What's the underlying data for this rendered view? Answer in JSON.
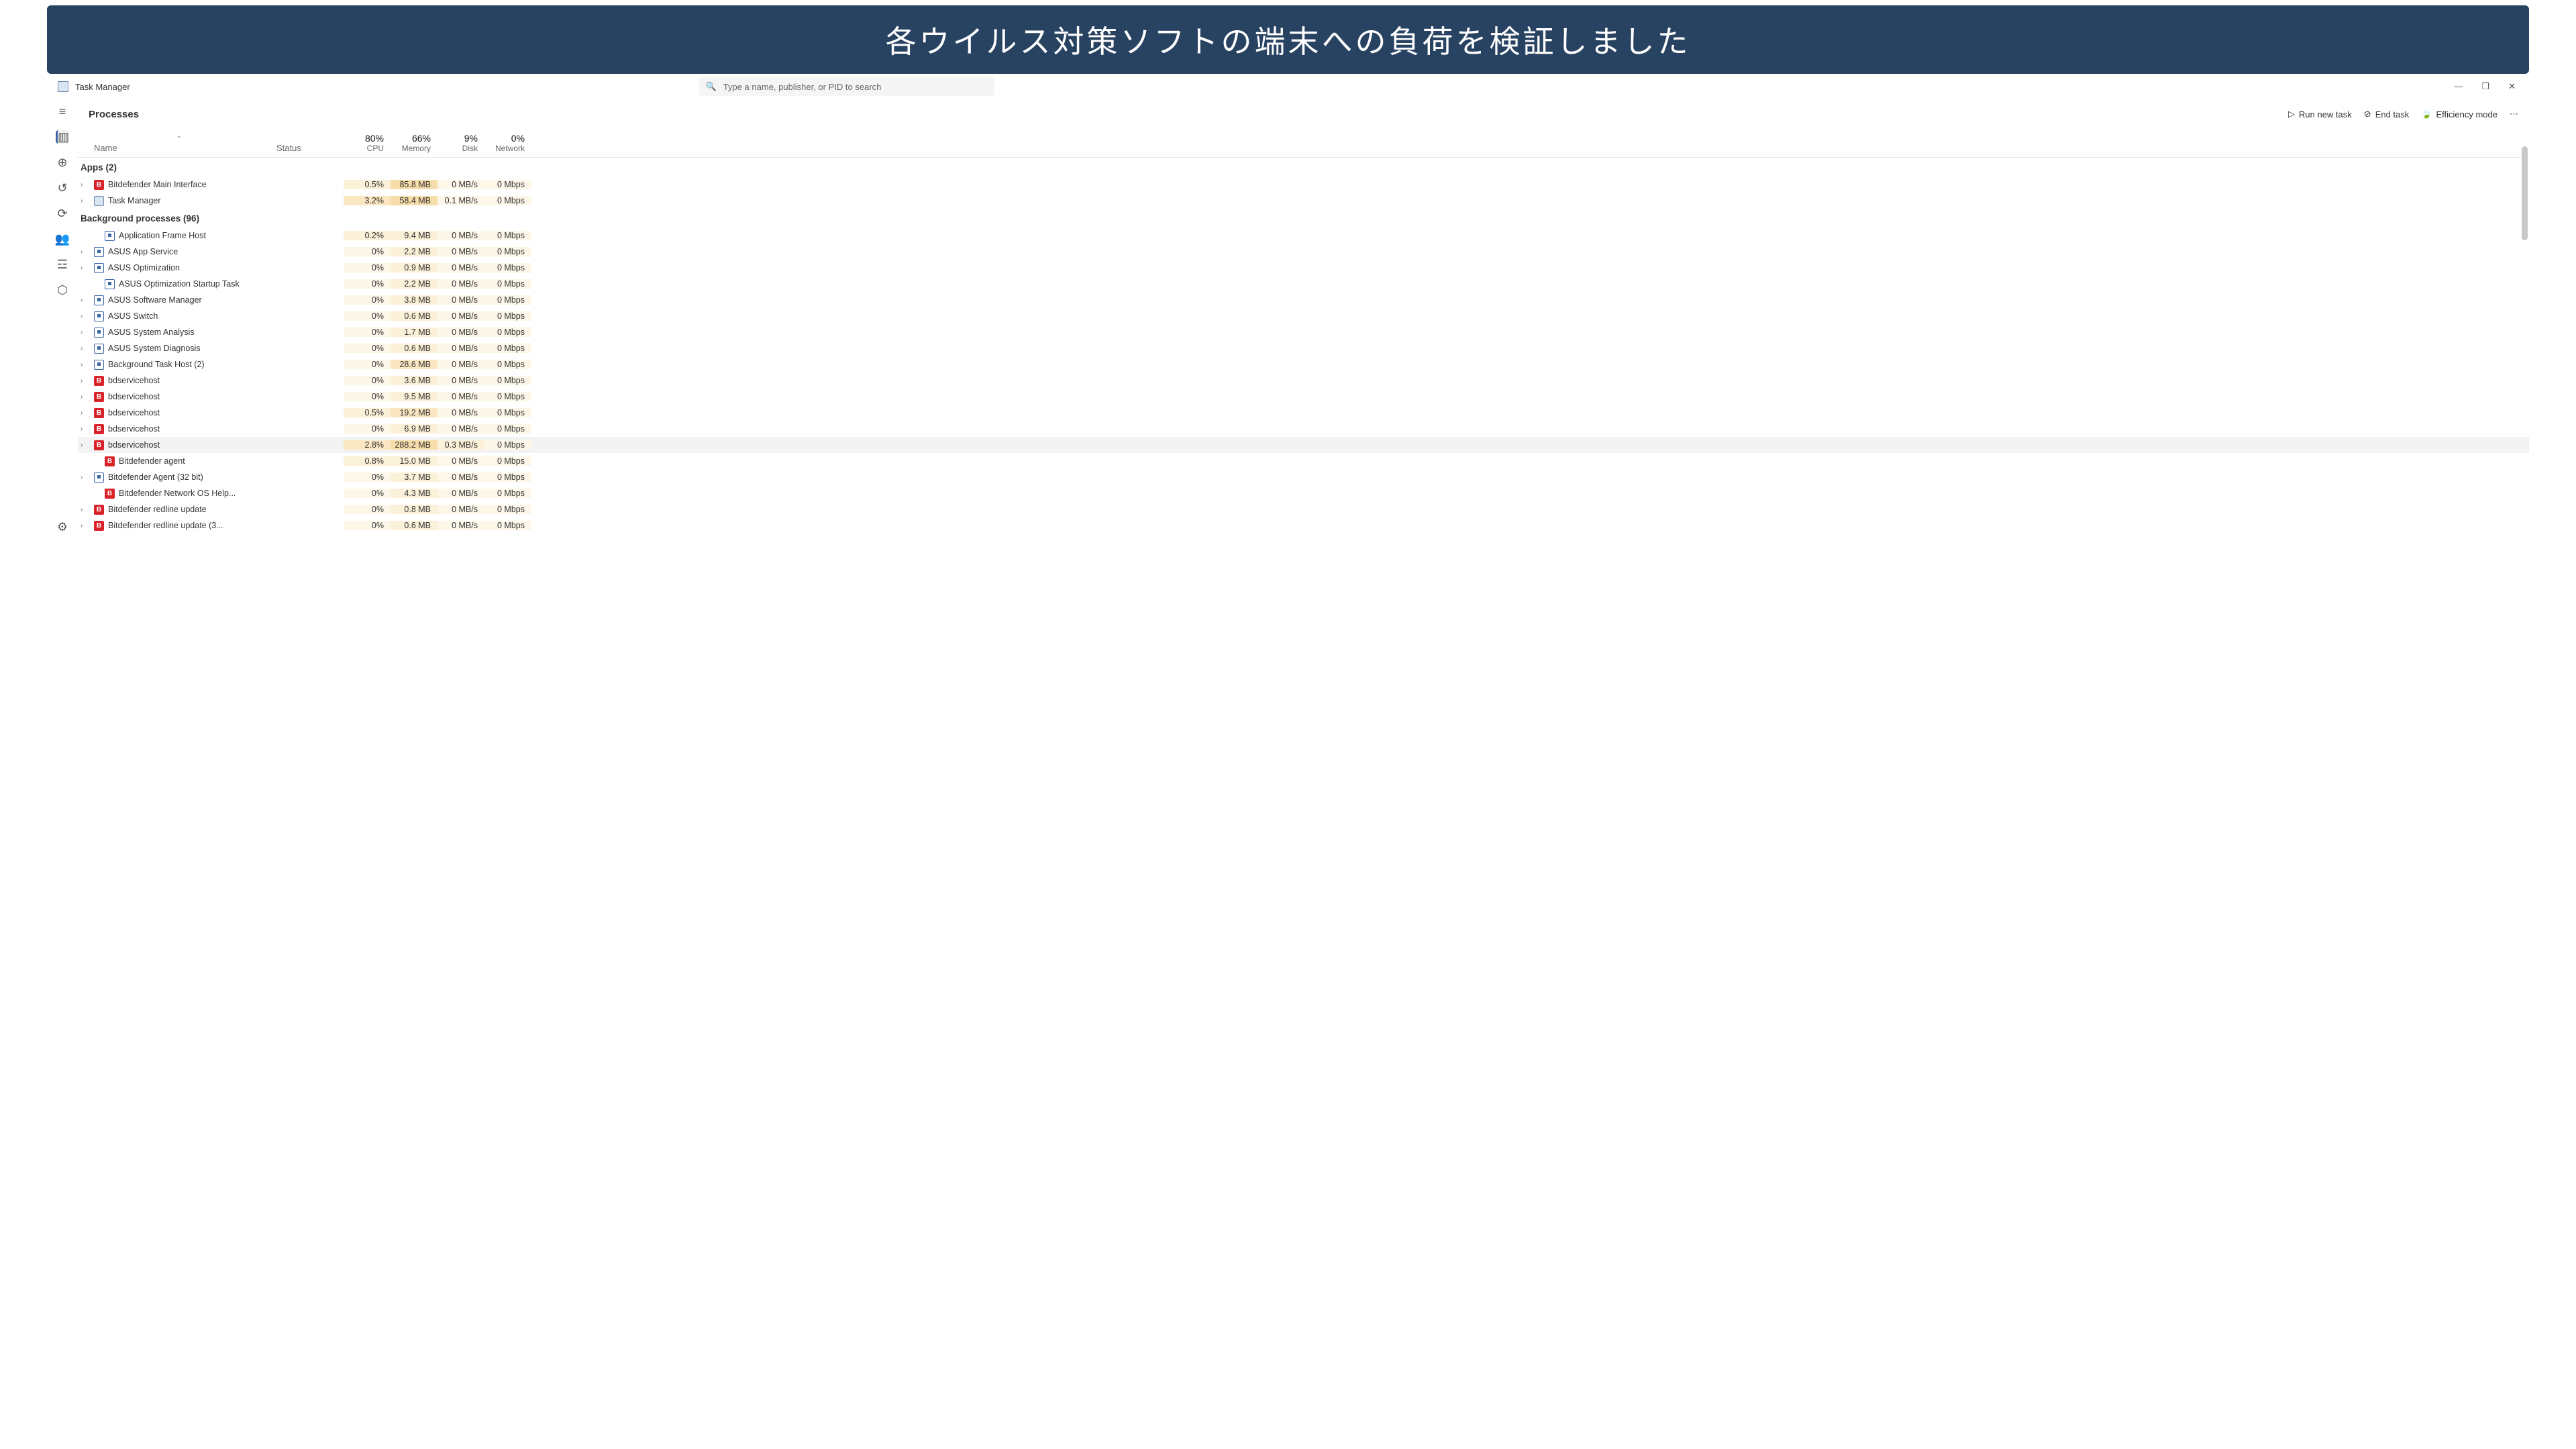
{
  "banner": "各ウイルス対策ソフトの端末への負荷を検証しました",
  "appTitle": "Task Manager",
  "searchPlaceholder": "Type a name, publisher, or PID to search",
  "pageHeading": "Processes",
  "actions": {
    "run": "Run new task",
    "end": "End task",
    "eff": "Efficiency mode"
  },
  "columns": {
    "name": "Name",
    "status": "Status",
    "cpu": {
      "pct": "80%",
      "lbl": "CPU"
    },
    "mem": {
      "pct": "66%",
      "lbl": "Memory"
    },
    "disk": {
      "pct": "9%",
      "lbl": "Disk"
    },
    "net": {
      "pct": "0%",
      "lbl": "Network"
    }
  },
  "groups": {
    "apps": "Apps (2)",
    "bg": "Background processes (96)"
  },
  "rows": [
    {
      "exp": true,
      "icon": "b",
      "name": "Bitdefender Main Interface",
      "cpu": "0.5%",
      "cpuH": 1,
      "mem": "85.8 MB",
      "memH": 3,
      "disk": "0 MB/s",
      "diskH": 0,
      "net": "0 Mbps",
      "netH": 0
    },
    {
      "exp": true,
      "icon": "tm",
      "name": "Task Manager",
      "cpu": "3.2%",
      "cpuH": 2,
      "mem": "58.4 MB",
      "memH": 3,
      "disk": "0.1 MB/s",
      "diskH": 0,
      "net": "0 Mbps",
      "netH": 0
    }
  ],
  "bgrows": [
    {
      "exp": false,
      "indent": true,
      "icon": "o",
      "name": "Application Frame Host",
      "cpu": "0.2%",
      "cpuH": 1,
      "mem": "9.4 MB",
      "memH": 1,
      "disk": "0 MB/s",
      "diskH": 0,
      "net": "0 Mbps",
      "netH": 0
    },
    {
      "exp": true,
      "icon": "o",
      "name": "ASUS App Service",
      "cpu": "0%",
      "cpuH": 0,
      "mem": "2.2 MB",
      "memH": 1,
      "disk": "0 MB/s",
      "diskH": 0,
      "net": "0 Mbps",
      "netH": 0
    },
    {
      "exp": true,
      "icon": "o",
      "name": "ASUS Optimization",
      "cpu": "0%",
      "cpuH": 0,
      "mem": "0.9 MB",
      "memH": 1,
      "disk": "0 MB/s",
      "diskH": 0,
      "net": "0 Mbps",
      "netH": 0
    },
    {
      "exp": false,
      "indent": true,
      "icon": "o",
      "name": "ASUS Optimization Startup Task",
      "cpu": "0%",
      "cpuH": 0,
      "mem": "2.2 MB",
      "memH": 1,
      "disk": "0 MB/s",
      "diskH": 0,
      "net": "0 Mbps",
      "netH": 0
    },
    {
      "exp": true,
      "icon": "o",
      "name": "ASUS Software Manager",
      "cpu": "0%",
      "cpuH": 0,
      "mem": "3.8 MB",
      "memH": 1,
      "disk": "0 MB/s",
      "diskH": 0,
      "net": "0 Mbps",
      "netH": 0
    },
    {
      "exp": true,
      "icon": "o",
      "name": "ASUS Switch",
      "cpu": "0%",
      "cpuH": 0,
      "mem": "0.6 MB",
      "memH": 1,
      "disk": "0 MB/s",
      "diskH": 0,
      "net": "0 Mbps",
      "netH": 0
    },
    {
      "exp": true,
      "icon": "o",
      "name": "ASUS System Analysis",
      "cpu": "0%",
      "cpuH": 0,
      "mem": "1.7 MB",
      "memH": 1,
      "disk": "0 MB/s",
      "diskH": 0,
      "net": "0 Mbps",
      "netH": 0
    },
    {
      "exp": true,
      "icon": "o",
      "name": "ASUS System Diagnosis",
      "cpu": "0%",
      "cpuH": 0,
      "mem": "0.6 MB",
      "memH": 1,
      "disk": "0 MB/s",
      "diskH": 0,
      "net": "0 Mbps",
      "netH": 0
    },
    {
      "exp": true,
      "icon": "o",
      "name": "Background Task Host (2)",
      "cpu": "0%",
      "cpuH": 0,
      "mem": "28.6 MB",
      "memH": 2,
      "disk": "0 MB/s",
      "diskH": 0,
      "net": "0 Mbps",
      "netH": 0
    },
    {
      "exp": true,
      "icon": "b",
      "name": "bdservicehost",
      "cpu": "0%",
      "cpuH": 0,
      "mem": "3.6 MB",
      "memH": 1,
      "disk": "0 MB/s",
      "diskH": 0,
      "net": "0 Mbps",
      "netH": 0
    },
    {
      "exp": true,
      "icon": "b",
      "name": "bdservicehost",
      "cpu": "0%",
      "cpuH": 0,
      "mem": "9.5 MB",
      "memH": 1,
      "disk": "0 MB/s",
      "diskH": 0,
      "net": "0 Mbps",
      "netH": 0
    },
    {
      "exp": true,
      "icon": "b",
      "name": "bdservicehost",
      "cpu": "0.5%",
      "cpuH": 1,
      "mem": "19.2 MB",
      "memH": 2,
      "disk": "0 MB/s",
      "diskH": 0,
      "net": "0 Mbps",
      "netH": 0
    },
    {
      "exp": true,
      "icon": "b",
      "name": "bdservicehost",
      "cpu": "0%",
      "cpuH": 0,
      "mem": "6.9 MB",
      "memH": 1,
      "disk": "0 MB/s",
      "diskH": 0,
      "net": "0 Mbps",
      "netH": 0
    },
    {
      "exp": true,
      "icon": "b",
      "name": "bdservicehost",
      "cpu": "2.8%",
      "cpuH": 2,
      "mem": "288.2 MB",
      "memH": 3,
      "disk": "0.3 MB/s",
      "diskH": 1,
      "net": "0 Mbps",
      "netH": 0,
      "sel": true
    },
    {
      "exp": false,
      "indent": true,
      "icon": "b",
      "name": "Bitdefender agent",
      "cpu": "0.8%",
      "cpuH": 1,
      "mem": "15.0 MB",
      "memH": 1,
      "disk": "0 MB/s",
      "diskH": 0,
      "net": "0 Mbps",
      "netH": 0
    },
    {
      "exp": true,
      "icon": "o",
      "name": "Bitdefender Agent (32 bit)",
      "cpu": "0%",
      "cpuH": 0,
      "mem": "3.7 MB",
      "memH": 1,
      "disk": "0 MB/s",
      "diskH": 0,
      "net": "0 Mbps",
      "netH": 0
    },
    {
      "exp": false,
      "indent": true,
      "icon": "b",
      "name": "Bitdefender Network OS Help...",
      "cpu": "0%",
      "cpuH": 0,
      "mem": "4.3 MB",
      "memH": 1,
      "disk": "0 MB/s",
      "diskH": 0,
      "net": "0 Mbps",
      "netH": 0
    },
    {
      "exp": true,
      "icon": "b",
      "name": "Bitdefender redline update",
      "cpu": "0%",
      "cpuH": 0,
      "mem": "0.8 MB",
      "memH": 1,
      "disk": "0 MB/s",
      "diskH": 0,
      "net": "0 Mbps",
      "netH": 0
    },
    {
      "exp": true,
      "icon": "b",
      "name": "Bitdefender redline update (3...",
      "cpu": "0%",
      "cpuH": 0,
      "mem": "0.6 MB",
      "memH": 1,
      "disk": "0 MB/s",
      "diskH": 0,
      "net": "0 Mbps",
      "netH": 0
    }
  ]
}
